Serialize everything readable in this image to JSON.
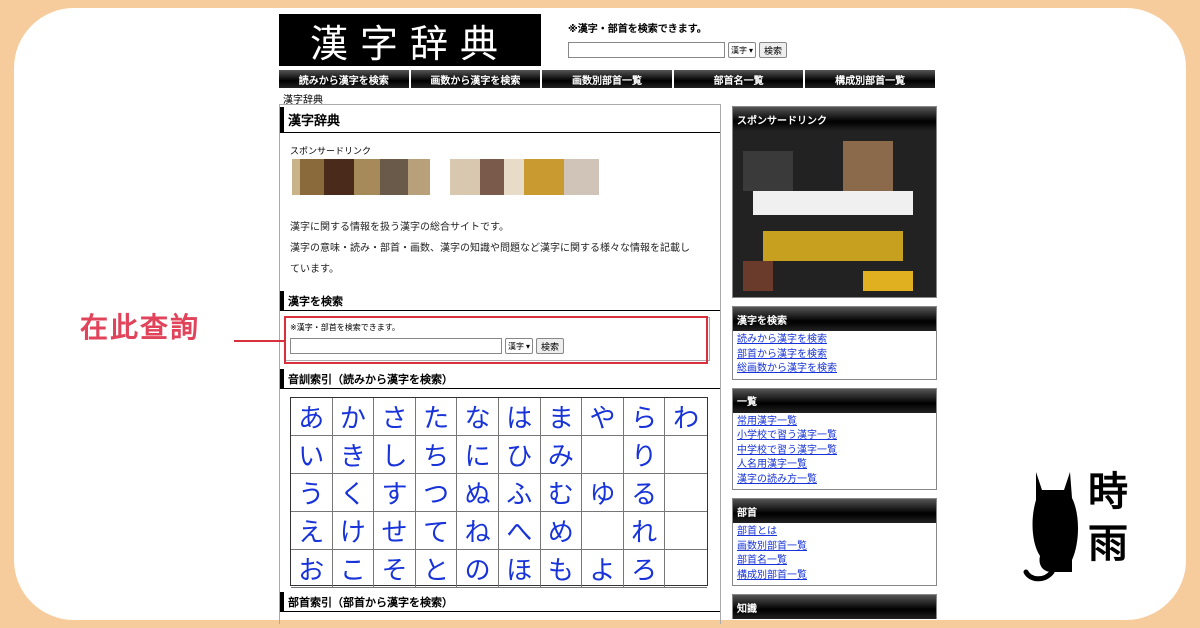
{
  "site": {
    "logo_text": "漢字辞典",
    "header_note": "※漢字・部首を検索できます。",
    "select_value": "漢字",
    "search_button": "検索"
  },
  "nav": [
    "読みから漢字を検索",
    "画数から漢字を検索",
    "画数別部首一覧",
    "部首名一覧",
    "構成別部首一覧"
  ],
  "breadcrumb": "漢字辞典",
  "main": {
    "title": "漢字辞典",
    "sponsor_label": "スポンサードリンク",
    "desc_line1": "漢字に関する情報を扱う漢字の総合サイトです。",
    "desc_line2": "漢字の意味・読み・部首・画数、漢字の知識や問題など漢字に関する様々な情報を記載し",
    "desc_line3": "ています。",
    "search_heading": "漢字を検索",
    "search_note": "※漢字・部首を検索できます。",
    "search_select": "漢字",
    "search_button": "検索",
    "onkun_heading": "音訓索引（読みから漢字を検索）",
    "bushu_heading": "部首索引（部首から漢字を検索）",
    "kana_rows": [
      [
        "あ",
        "か",
        "さ",
        "た",
        "な",
        "は",
        "ま",
        "や",
        "ら",
        "わ"
      ],
      [
        "い",
        "き",
        "し",
        "ち",
        "に",
        "ひ",
        "み",
        "",
        "り",
        ""
      ],
      [
        "う",
        "く",
        "す",
        "つ",
        "ぬ",
        "ふ",
        "む",
        "ゆ",
        "る",
        ""
      ],
      [
        "え",
        "け",
        "せ",
        "て",
        "ね",
        "へ",
        "め",
        "",
        "れ",
        ""
      ],
      [
        "お",
        "こ",
        "そ",
        "と",
        "の",
        "ほ",
        "も",
        "よ",
        "ろ",
        ""
      ]
    ]
  },
  "annotation": {
    "label": "在此查詢",
    "color": "#d9303e"
  },
  "side": {
    "sponsor_heading": "スポンサードリンク",
    "search_heading": "漢字を検索",
    "search_links": [
      "読みから漢字を検索",
      "部首から漢字を検索",
      "総画数から漢字を検索"
    ],
    "list_heading": "一覧",
    "list_links": [
      "常用漢字一覧",
      "小学校で習う漢字一覧",
      "中学校で習う漢字一覧",
      "人名用漢字一覧",
      "漢字の読み方一覧"
    ],
    "bushu_heading": "部首",
    "bushu_links": [
      "部首とは",
      "画数別部首一覧",
      "部首名一覧",
      "構成別部首一覧"
    ],
    "chishiki_heading": "知識"
  },
  "badge": {
    "chars": [
      "時",
      "雨"
    ],
    "icon": "cat-silhouette-icon"
  },
  "colors": {
    "frame": "#f6cc9c",
    "link": "#1733d9",
    "callout": "#e0435a"
  }
}
